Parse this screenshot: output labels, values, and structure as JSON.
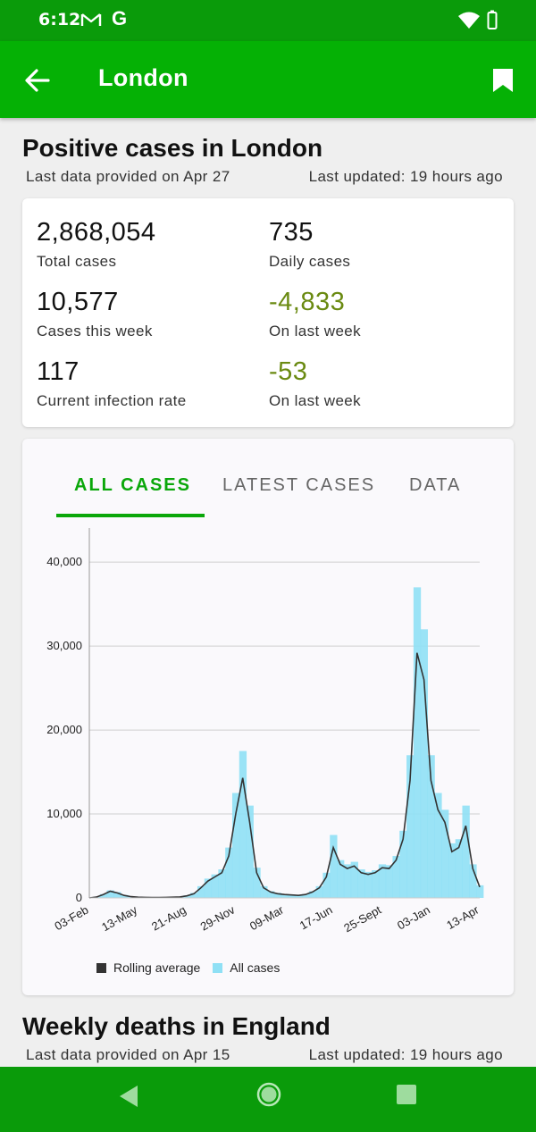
{
  "status_bar": {
    "time": "6:12",
    "g_label": "G"
  },
  "app_bar": {
    "title": "London"
  },
  "cases_section": {
    "title": "Positive cases in London",
    "last_data": "Last data provided on Apr 27",
    "last_updated": "Last updated: 19 hours ago"
  },
  "stats": [
    {
      "value": "2,868,054",
      "label": "Total cases"
    },
    {
      "value": "735",
      "label": "Daily cases"
    },
    {
      "value": "10,577",
      "label": "Cases this week"
    },
    {
      "value": "-4,833",
      "label": "On last week"
    },
    {
      "value": "117",
      "label": "Current infection rate"
    },
    {
      "value": "-53",
      "label": "On last week"
    }
  ],
  "tabs": [
    {
      "label": "ALL CASES",
      "active": true
    },
    {
      "label": "LATEST CASES",
      "active": false
    },
    {
      "label": "DATA",
      "active": false
    }
  ],
  "colors": {
    "brand_green": "#05b105",
    "negative_green": "#6a8a11",
    "bar_blue": "#8fe0f5",
    "line_dark": "#333333"
  },
  "chart_data": {
    "type": "area",
    "xlabel": "",
    "ylabel": "",
    "ylim": [
      0,
      43000
    ],
    "yticks": [
      "0",
      "10,000",
      "20,000",
      "30,000",
      "40,000"
    ],
    "ytick_values": [
      0,
      10000,
      20000,
      30000,
      40000
    ],
    "xticks": [
      "03-Feb",
      "13-May",
      "21-Aug",
      "29-Nov",
      "09-Mar",
      "17-Jun",
      "25-Sept",
      "03-Jan",
      "13-Apr"
    ],
    "x": [
      "03-Feb",
      "17-Feb",
      "02-Mar",
      "16-Mar",
      "30-Mar",
      "13-Apr",
      "27-Apr",
      "13-May",
      "27-May",
      "10-Jun",
      "24-Jun",
      "08-Jul",
      "22-Jul",
      "05-Aug",
      "21-Aug",
      "04-Sep",
      "18-Sep",
      "02-Oct",
      "16-Oct",
      "30-Oct",
      "13-Nov",
      "29-Nov",
      "13-Dec",
      "27-Dec",
      "10-Jan",
      "24-Jan",
      "07-Feb",
      "21-Feb",
      "09-Mar",
      "23-Mar",
      "06-Apr",
      "20-Apr",
      "04-May",
      "18-May",
      "03-Jun",
      "17-Jun",
      "01-Jul",
      "15-Jul",
      "29-Jul",
      "12-Aug",
      "26-Aug",
      "09-Sep",
      "25-Sept",
      "09-Oct",
      "23-Oct",
      "06-Nov",
      "20-Nov",
      "04-Dec",
      "18-Dec",
      "03-Jan",
      "17-Jan",
      "31-Jan",
      "14-Feb",
      "28-Feb",
      "14-Mar",
      "28-Mar",
      "13-Apr"
    ],
    "series": [
      {
        "name": "Rolling average",
        "values": [
          0,
          100,
          400,
          800,
          600,
          300,
          150,
          80,
          60,
          50,
          50,
          60,
          80,
          120,
          250,
          500,
          1200,
          2000,
          2500,
          3000,
          5000,
          10000,
          14300,
          9000,
          3000,
          1200,
          700,
          500,
          400,
          350,
          300,
          400,
          700,
          1200,
          2500,
          6000,
          4000,
          3500,
          3800,
          3000,
          2800,
          3000,
          3600,
          3500,
          4500,
          7000,
          14000,
          29200,
          26000,
          14000,
          10500,
          9000,
          5500,
          6000,
          8600,
          3500,
          1300
        ]
      },
      {
        "name": "All cases",
        "values": [
          0,
          120,
          450,
          900,
          700,
          350,
          180,
          90,
          70,
          60,
          60,
          70,
          100,
          150,
          300,
          600,
          1400,
          2300,
          2800,
          3400,
          6000,
          12500,
          17500,
          11000,
          3600,
          1400,
          800,
          600,
          450,
          400,
          350,
          450,
          800,
          1400,
          3000,
          7500,
          4500,
          4000,
          4300,
          3400,
          3100,
          3300,
          4000,
          3900,
          5000,
          8000,
          17000,
          37000,
          32000,
          17000,
          12500,
          10500,
          6500,
          7000,
          11000,
          4000,
          1500
        ]
      }
    ],
    "legend": [
      "Rolling average",
      "All cases"
    ],
    "legend_position": "bottom",
    "grid": true
  },
  "deaths_section": {
    "title": "Weekly deaths in England",
    "last_data": "Last data provided on Apr 15",
    "last_updated": "Last updated: 19 hours ago"
  }
}
